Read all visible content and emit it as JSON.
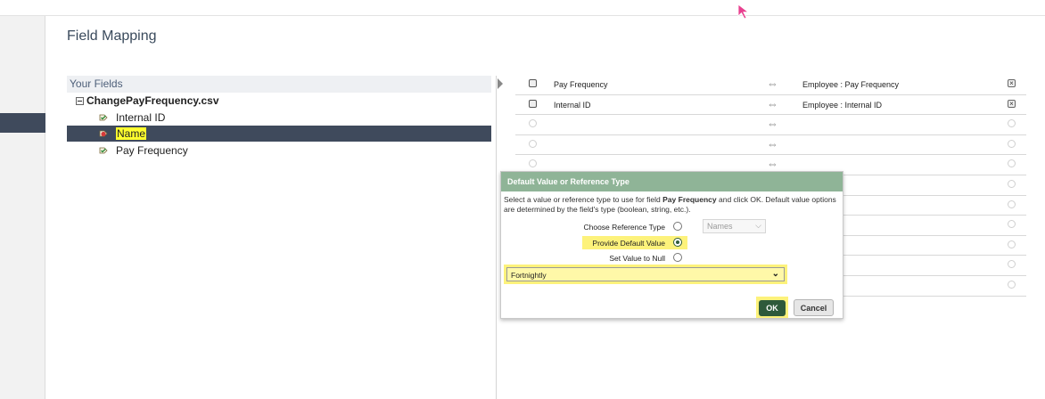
{
  "page": {
    "title": "Field Mapping"
  },
  "fields_panel": {
    "header": "Your Fields",
    "root": "ChangePayFrequency.csv",
    "items": [
      {
        "label": "Internal ID",
        "selected": false
      },
      {
        "label": "Name",
        "selected": true
      },
      {
        "label": "Pay Frequency",
        "selected": false
      }
    ]
  },
  "mapping": {
    "rows": [
      {
        "source": "Pay Frequency",
        "target": "Employee : Pay Frequency"
      },
      {
        "source": "Internal ID",
        "target": "Employee : Internal ID"
      },
      {
        "source": "",
        "target": ""
      },
      {
        "source": "",
        "target": ""
      },
      {
        "source": "",
        "target": ""
      },
      {
        "source": "",
        "target": ""
      },
      {
        "source": "",
        "target": ""
      },
      {
        "source": "",
        "target": ""
      },
      {
        "source": "",
        "target": ""
      },
      {
        "source": "",
        "target": ""
      },
      {
        "source": "",
        "target": ""
      }
    ],
    "arrow_glyph": "⇔"
  },
  "dialog": {
    "title": "Default Value or Reference Type",
    "desc_pre": "Select a value or reference type to use for field ",
    "desc_field": "Pay Frequency",
    "desc_post": " and click OK. Default value options are determined by the field's type (boolean, string, etc.).",
    "choose_label": "Choose Reference Type",
    "reference_type_value": "Names",
    "default_label": "Provide Default Value",
    "null_label": "Set Value to Null",
    "default_value": "Fortnightly",
    "ok_label": "OK",
    "cancel_label": "Cancel"
  },
  "colors": {
    "accent": "#2e5a3b",
    "dialog_header": "#8fb497",
    "highlight": "#fdf27b",
    "selection": "#3f4a5c"
  }
}
